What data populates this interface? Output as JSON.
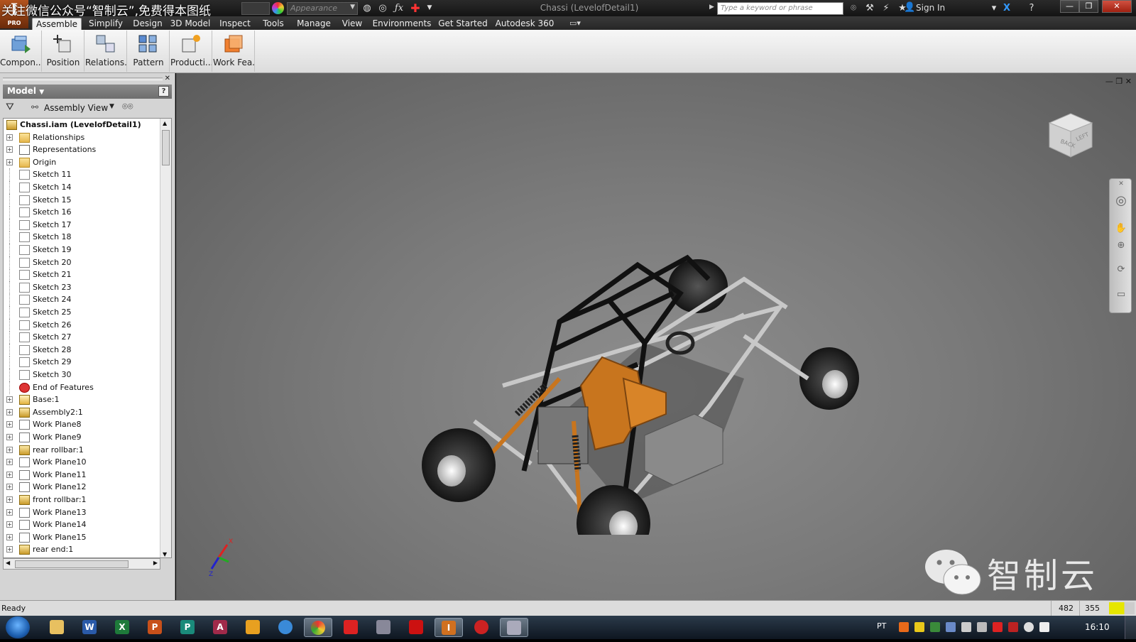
{
  "titlebar": {
    "logo_letter": "I",
    "logo_badge": "PRO",
    "watermark_top": "关注微信公众号“智制云”,免费得本图纸",
    "appearance_placeholder": "Appearance",
    "window_title": "Chassi (LevelofDetail1)",
    "search_placeholder": "Type a keyword or phrase",
    "sign_in": "Sign In",
    "qat_icons": [
      "material-color-icon",
      "clear-appearance-icon",
      "adjust-icon",
      "fx-icon",
      "new-icon"
    ],
    "window_buttons": [
      "minimize",
      "restore",
      "close"
    ]
  },
  "ribbon": {
    "tabs": [
      "Assemble",
      "Simplify",
      "Design",
      "3D Model",
      "Inspect",
      "Tools",
      "Manage",
      "View",
      "Environments",
      "Get Started",
      "Autodesk 360"
    ],
    "active_tab": "Assemble",
    "buttons": [
      "Compon...",
      "Position",
      "Relations...",
      "Pattern",
      "Producti...",
      "Work Fea..."
    ]
  },
  "browser": {
    "header": "Model",
    "help": "?",
    "view_select": "Assembly View",
    "tree": [
      {
        "label": "Chassi.iam (LevelofDetail1)",
        "icon": "assembly-root-icon",
        "expander": false,
        "root": true
      },
      {
        "label": "Relationships",
        "icon": "folder-icon",
        "expander": true
      },
      {
        "label": "Representations",
        "icon": "representations-icon",
        "expander": true
      },
      {
        "label": "Origin",
        "icon": "folder-icon",
        "expander": true
      },
      {
        "label": "Sketch 11",
        "icon": "sketch-icon",
        "expander": false
      },
      {
        "label": "Sketch 14",
        "icon": "sketch-icon",
        "expander": false
      },
      {
        "label": "Sketch 15",
        "icon": "sketch-icon",
        "expander": false
      },
      {
        "label": "Sketch 16",
        "icon": "sketch-icon",
        "expander": false
      },
      {
        "label": "Sketch 17",
        "icon": "sketch-icon",
        "expander": false
      },
      {
        "label": "Sketch 18",
        "icon": "sketch-icon",
        "expander": false
      },
      {
        "label": "Sketch 19",
        "icon": "sketch-icon",
        "expander": false
      },
      {
        "label": "Sketch 20",
        "icon": "sketch-icon",
        "expander": false
      },
      {
        "label": "Sketch 21",
        "icon": "sketch-icon",
        "expander": false
      },
      {
        "label": "Sketch 23",
        "icon": "sketch-icon",
        "expander": false
      },
      {
        "label": "Sketch 24",
        "icon": "sketch-icon",
        "expander": false
      },
      {
        "label": "Sketch 25",
        "icon": "sketch-icon",
        "expander": false
      },
      {
        "label": "Sketch 26",
        "icon": "sketch-icon",
        "expander": false
      },
      {
        "label": "Sketch 27",
        "icon": "sketch-icon",
        "expander": false
      },
      {
        "label": "Sketch 28",
        "icon": "sketch-icon",
        "expander": false
      },
      {
        "label": "Sketch 29",
        "icon": "sketch-icon",
        "expander": false
      },
      {
        "label": "Sketch 30",
        "icon": "sketch-icon",
        "expander": false
      },
      {
        "label": "End of Features",
        "icon": "end-of-features-icon",
        "expander": false
      },
      {
        "label": "Base:1",
        "icon": "part-icon",
        "expander": true
      },
      {
        "label": "Assembly2:1",
        "icon": "subassembly-icon",
        "expander": true
      },
      {
        "label": "Work Plane8",
        "icon": "work-plane-icon",
        "expander": true
      },
      {
        "label": "Work Plane9",
        "icon": "work-plane-icon",
        "expander": true
      },
      {
        "label": "rear rollbar:1",
        "icon": "subassembly-icon",
        "expander": true
      },
      {
        "label": "Work Plane10",
        "icon": "work-plane-icon",
        "expander": true
      },
      {
        "label": "Work Plane11",
        "icon": "work-plane-icon",
        "expander": true
      },
      {
        "label": "Work Plane12",
        "icon": "work-plane-icon",
        "expander": true
      },
      {
        "label": "front rollbar:1",
        "icon": "subassembly-icon",
        "expander": true
      },
      {
        "label": "Work Plane13",
        "icon": "work-plane-icon",
        "expander": true
      },
      {
        "label": "Work Plane14",
        "icon": "work-plane-icon",
        "expander": true
      },
      {
        "label": "Work Plane15",
        "icon": "work-plane-icon",
        "expander": true
      },
      {
        "label": "rear end:1",
        "icon": "subassembly-icon",
        "expander": true
      }
    ]
  },
  "viewport": {
    "viewcube_faces": [
      "BACK",
      "LEFT"
    ],
    "triad_axes": [
      "X",
      "Z"
    ],
    "watermark_text": "智制云",
    "model_colors": {
      "frame": "#1a1a1a",
      "tubes": "#bfbfbf",
      "seat": "#c8751e",
      "tires": "#2a2a2a",
      "box": "#8a8a8a"
    }
  },
  "status": {
    "text": "Ready",
    "num1": "482",
    "num2": "355"
  },
  "taskbar": {
    "apps": [
      "Explorer",
      "W",
      "X",
      "P",
      "P",
      "A",
      "Media",
      "IE",
      "Chrome",
      "SolidWorks",
      "Tool",
      "Acrobat",
      "I",
      "Info",
      "Tool2"
    ],
    "active_app_index": 12,
    "tray_lang": "PT",
    "clock": "16:10"
  }
}
